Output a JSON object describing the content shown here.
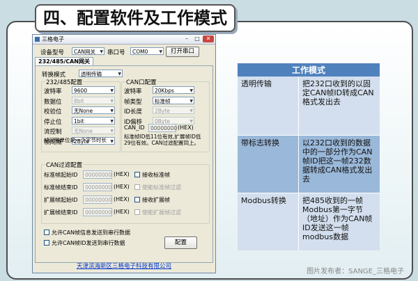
{
  "heading": "四、配置软件及工作模式",
  "window": {
    "title": "三格电子",
    "controls": {
      "minimize": "–",
      "maximize": "□",
      "close": "✕"
    },
    "device_label": "设备型号",
    "device_value": "CAN网关",
    "port_label": "串口号",
    "port_value": "COM0",
    "open_button": "打开串口",
    "tab": "232/485/CAN网关",
    "mode_label": "转换模式",
    "mode_value": "透明传输",
    "serial_group": {
      "title": "232/485配置",
      "fields": [
        {
          "label": "波特率",
          "value": "9600",
          "disabled": false
        },
        {
          "label": "数据位",
          "value": "8bit",
          "disabled": true
        },
        {
          "label": "校验位",
          "value": "无None",
          "disabled": false
        },
        {
          "label": "停止位",
          "value": "1bit",
          "disabled": false
        },
        {
          "label": "流控制",
          "value": "无None",
          "disabled": true
        },
        {
          "label": "帧间隔",
          "value": "2Byte",
          "disabled": false
        }
      ],
      "note": "帧间隔单位是一个字节时长"
    },
    "can_group": {
      "title": "CAN口配置",
      "fields": [
        {
          "label": "波特率",
          "value": "20Kbps",
          "disabled": false
        },
        {
          "label": "帧类型",
          "value": "标准帧",
          "disabled": false
        },
        {
          "label": "ID长度",
          "value": "2Byte",
          "disabled": true
        },
        {
          "label": "ID偏移",
          "value": "0Byte",
          "disabled": true
        }
      ],
      "can_id_label": "CAN_ID",
      "can_id_value": "00000000",
      "hex": "(HEX)",
      "note": "标准帧ID低11位有效,扩展帧ID低29位有效。CAN过滤配置同上。"
    },
    "filter_group": {
      "title": "CAN过滤配置",
      "rows": [
        {
          "label": "标准帧起始ID",
          "value": "00000000",
          "hex": "(HEX)",
          "check": "接收标准帧",
          "check_disabled": false
        },
        {
          "label": "标准帧结束ID",
          "value": "00000000",
          "hex": "(HEX)",
          "check": "使能标准帧过滤",
          "check_disabled": true
        },
        {
          "label": "扩展帧起始ID",
          "value": "00000000",
          "hex": "(HEX)",
          "check": "接收扩展帧",
          "check_disabled": false
        },
        {
          "label": "扩展帧结束ID",
          "value": "00000000",
          "hex": "(HEX)",
          "check": "使能扩展帧过滤",
          "check_disabled": true
        }
      ]
    },
    "allow_info": "允许CAN帧信息发送到串行数据",
    "allow_id": "允许CAN帧ID发送到串行数据",
    "config_button": "配置",
    "footer": "天津滨海新区三格电子科技有限公司"
  },
  "table": {
    "header": "工作模式",
    "rows": [
      {
        "mode": "透明传输",
        "desc": "把232口收到的以固定CAN帧ID转成CAN格式发出去"
      },
      {
        "mode": "带标志转换",
        "desc": "以232口收到的数据中的一部分作为CAN帧ID把这一帧232数据转成CAN格式发出去"
      },
      {
        "mode": "Modbus转换",
        "desc": "把485收到的一帧Modbus第一字节（地址）作为CAN帧ID发送这一帧modbus数据"
      }
    ]
  },
  "caption": "图片发布者：SANGE_三格电子"
}
